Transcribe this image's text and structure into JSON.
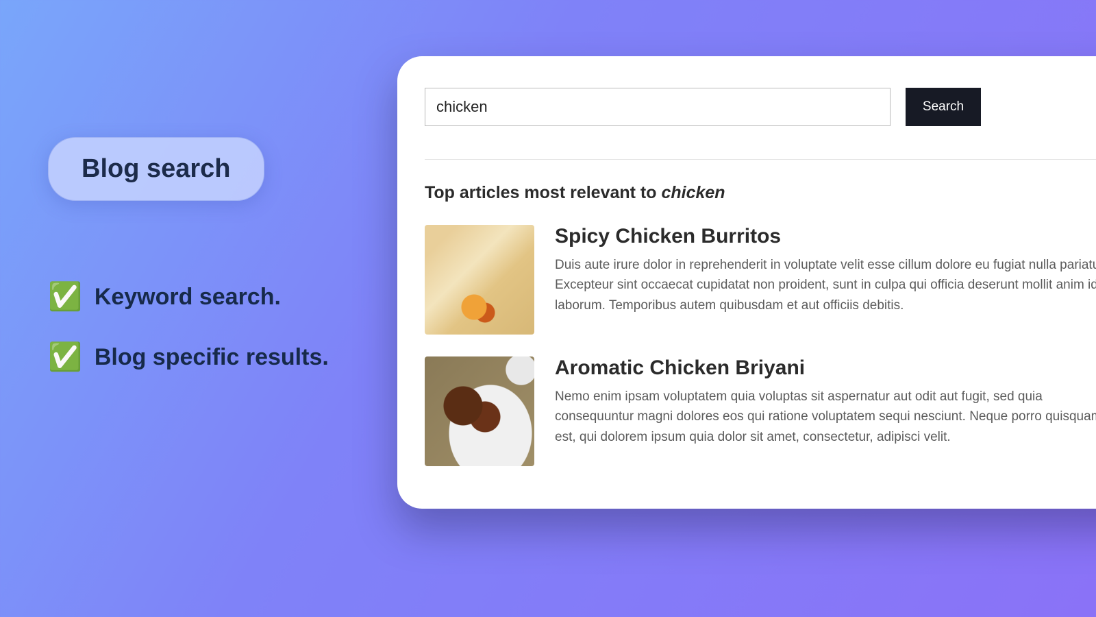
{
  "promo": {
    "pill_label": "Blog search",
    "features": [
      {
        "text": "Keyword search."
      },
      {
        "text": "Blog specific results."
      }
    ]
  },
  "search": {
    "query": "chicken",
    "button_label": "Search"
  },
  "results": {
    "heading_prefix": "Top articles most relevant to ",
    "heading_term": "chicken",
    "items": [
      {
        "title": "Spicy Chicken Burritos",
        "snippet": "Duis aute irure dolor in reprehenderit in voluptate velit esse cillum dolore eu fugiat nulla pariatur. Excepteur sint occaecat cupidatat non proident, sunt in culpa qui officia deserunt mollit anim id est laborum. Temporibus autem quibusdam et aut officiis debitis."
      },
      {
        "title": "Aromatic Chicken Briyani",
        "snippet": "Nemo enim ipsam voluptatem quia voluptas sit aspernatur aut odit aut fugit, sed quia consequuntur magni dolores eos qui ratione voluptatem sequi nesciunt. Neque porro quisquam est, qui dolorem ipsum quia dolor sit amet, consectetur, adipisci velit."
      }
    ]
  }
}
